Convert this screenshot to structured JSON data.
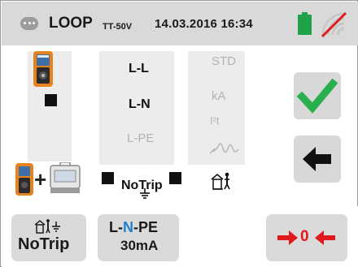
{
  "status_bar": {
    "title": "LOOP",
    "title_suffix": "TT-50V",
    "datetime": "14.03.2016 16:34",
    "icons": {
      "menu": "menu-dots-icon",
      "battery": "battery-full-icon",
      "signal": "no-signal-icon"
    },
    "colors": {
      "battery": "#1fa24a",
      "no_signal_slash": "#e0191c"
    }
  },
  "mode_column": {
    "modes": [
      {
        "label": "L-L",
        "active": true
      },
      {
        "label": "L-N",
        "active": true
      },
      {
        "label": "L-PE",
        "active": false
      }
    ]
  },
  "type_column": {
    "items": [
      {
        "label": "STD",
        "active": false
      },
      {
        "label": "kA",
        "active": false
      },
      {
        "label": "I²t",
        "active": false
      }
    ]
  },
  "bottom_row_label": "NoTrip",
  "bottom_bar": {
    "tab1": {
      "label": "NoTrip"
    },
    "tab2": {
      "line1_l": "L-",
      "line1_n": "N",
      "line1_pe": "-PE",
      "line2": "30mA"
    },
    "tab3": {
      "label": "0"
    }
  },
  "colors": {
    "confirm_check": "#29b04c",
    "device_orange": "#e8821e",
    "n_blue": "#1f7fd1",
    "zero_red": "#e0191c"
  }
}
